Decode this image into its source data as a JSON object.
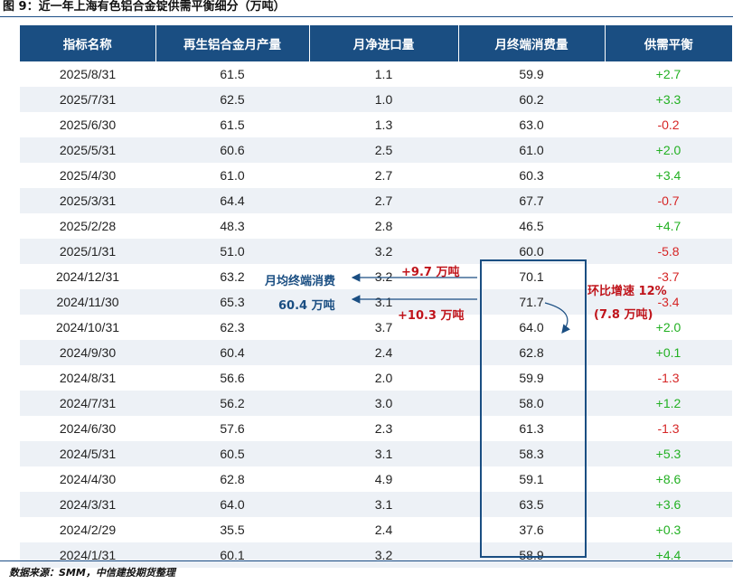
{
  "title": "图 9：近一年上海有色铝合金锭供需平衡细分（万吨）",
  "table": {
    "headers": [
      "指标名称",
      "再生铝合金月产量",
      "月净进口量",
      "月终端消费量",
      "供需平衡"
    ],
    "rows": [
      [
        "2025/8/31",
        "61.5",
        "1.1",
        "59.9",
        "+2.7"
      ],
      [
        "2025/7/31",
        "62.5",
        "1.0",
        "60.2",
        "+3.3"
      ],
      [
        "2025/6/30",
        "61.5",
        "1.3",
        "63.0",
        "-0.2"
      ],
      [
        "2025/5/31",
        "60.6",
        "2.5",
        "61.0",
        "+2.0"
      ],
      [
        "2025/4/30",
        "61.0",
        "2.7",
        "60.3",
        "+3.4"
      ],
      [
        "2025/3/31",
        "64.4",
        "2.7",
        "67.7",
        "-0.7"
      ],
      [
        "2025/2/28",
        "48.3",
        "2.8",
        "46.5",
        "+4.7"
      ],
      [
        "2025/1/31",
        "51.0",
        "3.2",
        "60.0",
        "-5.8"
      ],
      [
        "2024/12/31",
        "63.2",
        "3.2",
        "70.1",
        "-3.7"
      ],
      [
        "2024/11/30",
        "65.3",
        "3.1",
        "71.7",
        "-3.4"
      ],
      [
        "2024/10/31",
        "62.3",
        "3.7",
        "64.0",
        "+2.0"
      ],
      [
        "2024/9/30",
        "60.4",
        "2.4",
        "62.8",
        "+0.1"
      ],
      [
        "2024/8/31",
        "56.6",
        "2.0",
        "59.9",
        "-1.3"
      ],
      [
        "2024/7/31",
        "56.2",
        "3.0",
        "58.0",
        "+1.2"
      ],
      [
        "2024/6/30",
        "57.6",
        "2.3",
        "61.3",
        "-1.3"
      ],
      [
        "2024/5/31",
        "60.5",
        "3.1",
        "58.3",
        "+5.3"
      ],
      [
        "2024/4/30",
        "62.8",
        "4.9",
        "59.1",
        "+8.6"
      ],
      [
        "2024/3/31",
        "64.0",
        "3.1",
        "63.5",
        "+3.6"
      ],
      [
        "2024/2/29",
        "35.5",
        "2.4",
        "37.6",
        "+0.3"
      ],
      [
        "2024/1/31",
        "60.1",
        "3.2",
        "58.9",
        "+4.4"
      ]
    ]
  },
  "annotations": {
    "avg_label": "月均终端消费",
    "avg_value": "60.4 万吨",
    "diff_dec": "+9.7 万吨",
    "diff_nov": "+10.3 万吨",
    "mom_label": "环比增速 12%",
    "mom_value": "(7.8 万吨)"
  },
  "footer": "数据来源：SMM，中信建投期货整理",
  "colors": {
    "header_bg": "#1a4e82",
    "positive": "#22b022",
    "negative": "#d62626",
    "annotation_red": "#c0141b"
  }
}
